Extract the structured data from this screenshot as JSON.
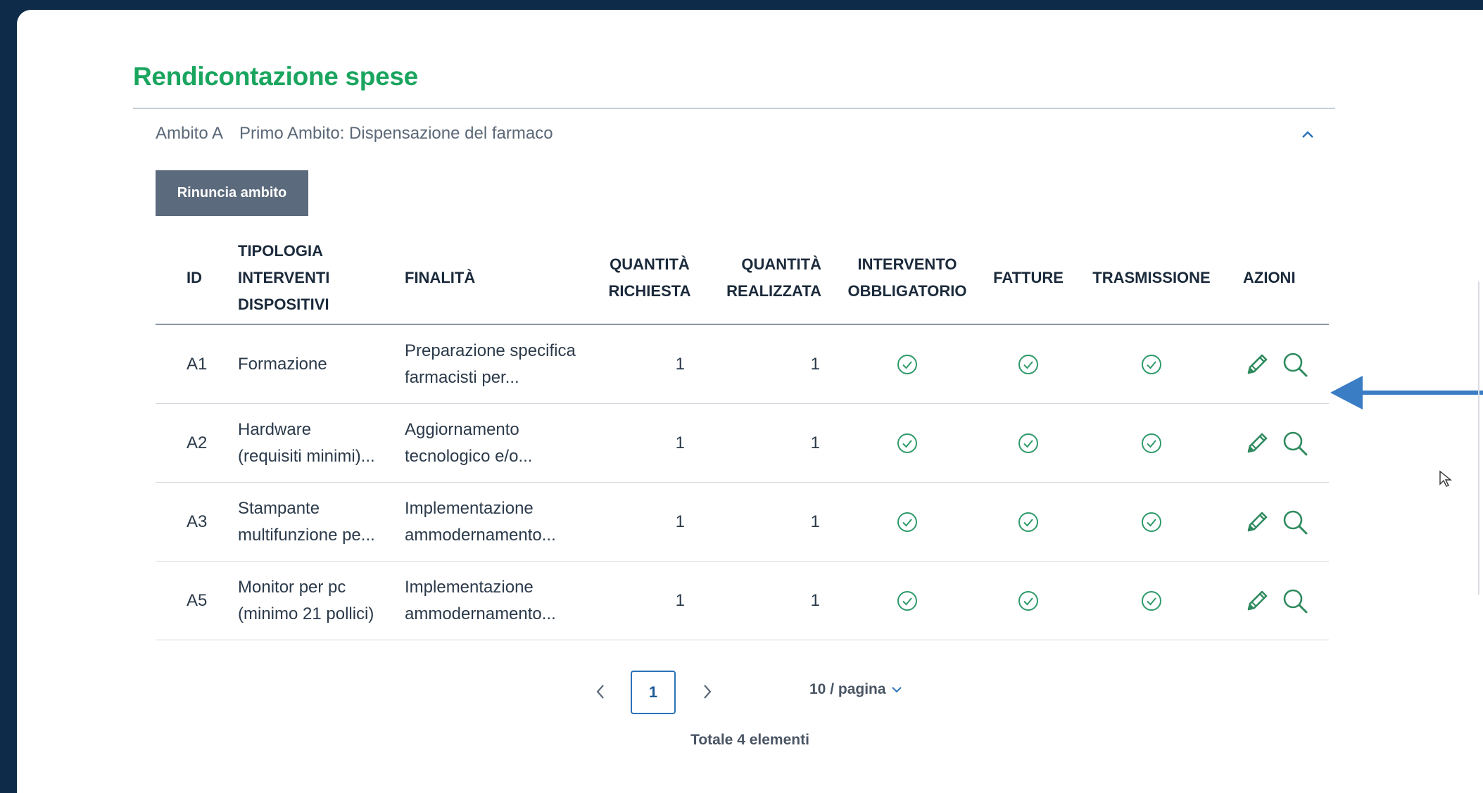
{
  "page": {
    "title": "Rendicontazione spese"
  },
  "ambito": {
    "code": "Ambito A",
    "name": "Primo Ambito: Dispensazione del farmaco",
    "rinuncia_label": "Rinuncia ambito"
  },
  "table": {
    "columns": {
      "id": "ID",
      "tipologia": "TIPOLOGIA\nINTERVENTI\nDISPOSITIVI",
      "finalita": "FINALITÀ",
      "qta_richiesta": "QUANTITÀ\nRICHIESTA",
      "qta_realizzata": "QUANTITÀ\nREALIZZATA",
      "obbligatorio": "INTERVENTO\nOBBLIGATORIO",
      "fatture": "FATTURE",
      "trasmissione": "TRASMISSIONE",
      "azioni": "AZIONI"
    },
    "rows": [
      {
        "id": "A1",
        "tipologia": "Formazione",
        "finalita": "Preparazione specifica\nfarmacisti per...",
        "qta_richiesta": "1",
        "qta_realizzata": "1"
      },
      {
        "id": "A2",
        "tipologia": "Hardware\n(requisiti minimi)...",
        "finalita": "Aggiornamento\ntecnologico e/o...",
        "qta_richiesta": "1",
        "qta_realizzata": "1"
      },
      {
        "id": "A3",
        "tipologia": "Stampante\nmultifunzione pe...",
        "finalita": "Implementazione\nammodernamento...",
        "qta_richiesta": "1",
        "qta_realizzata": "1"
      },
      {
        "id": "A5",
        "tipologia": "Monitor per pc\n(minimo 21 pollici)",
        "finalita": "Implementazione\nammodernamento...",
        "qta_richiesta": "1",
        "qta_realizzata": "1"
      }
    ],
    "status_icon": "check-circle-icon",
    "actions": [
      "pencil-icon",
      "search-icon"
    ]
  },
  "pagination": {
    "current_page": "1",
    "page_size": "10 / pagina",
    "total": "Totale 4 elementi"
  },
  "colors": {
    "title": "#1aa55f",
    "check": "#2e9a6a",
    "button": "#5b6a7c",
    "arrow": "#3a7dc4",
    "background": "#0e2c4a"
  }
}
